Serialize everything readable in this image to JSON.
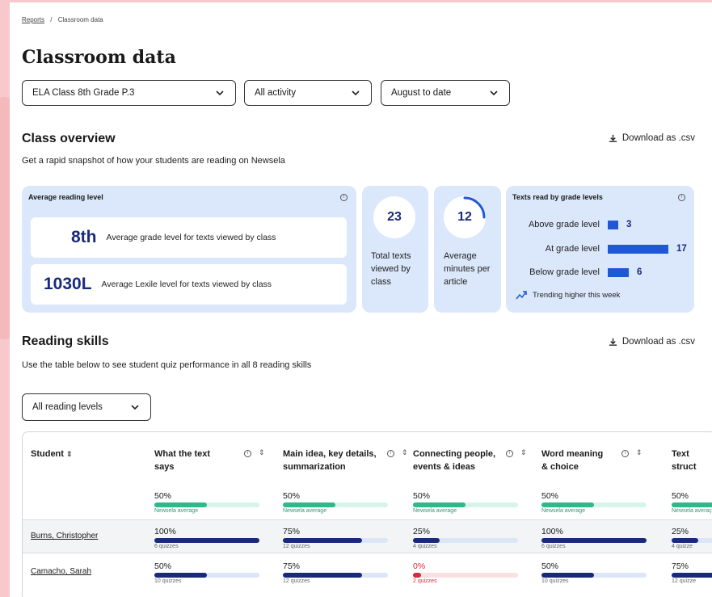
{
  "breadcrumb": {
    "link": "Reports",
    "sep": "/",
    "current": "Classroom data"
  },
  "page_title": "Classroom data",
  "filters": [
    {
      "value": "ELA Class 8th Grade P.3"
    },
    {
      "value": "All activity"
    },
    {
      "value": "August to date"
    }
  ],
  "overview": {
    "title": "Class overview",
    "subtitle": "Get a rapid snapshot of how your students are reading on Newsela",
    "download": "Download as .csv",
    "avg_reading": {
      "title": "Average reading level",
      "grade_value": "8th",
      "grade_desc": "Average grade level for texts viewed by class",
      "lexile_value": "1030L",
      "lexile_desc": "Average Lexile level for texts viewed by class"
    },
    "total_texts": {
      "value": "23",
      "l1": "Total texts",
      "l2": "viewed by",
      "l3": "class"
    },
    "avg_minutes": {
      "value": "12",
      "l1": "Average",
      "l2": "minutes per",
      "l3": "article",
      "ring_fraction": 0.25
    },
    "grade_levels": {
      "title": "Texts read by grade levels",
      "items": [
        {
          "label": "Above grade level",
          "value": "3",
          "num": 3
        },
        {
          "label": "At grade level",
          "value": "17",
          "num": 17
        },
        {
          "label": "Below grade level",
          "value": "6",
          "num": 6
        }
      ],
      "trend": "Trending higher this week"
    }
  },
  "skills": {
    "title": "Reading skills",
    "subtitle": "Use the table below to see student quiz performance in all 8 reading skills",
    "download": "Download as .csv",
    "level_filter": "All reading levels",
    "columns": [
      {
        "l1": "Student",
        "l2": ""
      },
      {
        "l1": "What the text",
        "l2": "says"
      },
      {
        "l1": "Main idea, key details,",
        "l2": "summarization"
      },
      {
        "l1": "Connecting people,",
        "l2": "events & ideas"
      },
      {
        "l1": "Word meaning",
        "l2": "& choice"
      },
      {
        "l1": "Text",
        "l2": "struct"
      }
    ],
    "averages": [
      {
        "pct": "50%",
        "frac": 0.5,
        "label": "Newsela average"
      },
      {
        "pct": "50%",
        "frac": 0.5,
        "label": "Newsela average"
      },
      {
        "pct": "50%",
        "frac": 0.5,
        "label": "Newsela average"
      },
      {
        "pct": "50%",
        "frac": 0.5,
        "label": "Newsela average"
      },
      {
        "pct": "50%",
        "frac": 0.5,
        "label": "Newsela averaç"
      }
    ],
    "students": [
      {
        "name": "Burns,  Christopher",
        "cells": [
          {
            "pct": "100%",
            "frac": 1.0,
            "q": "6 quizzes"
          },
          {
            "pct": "75%",
            "frac": 0.75,
            "q": "12 quizzes"
          },
          {
            "pct": "25%",
            "frac": 0.25,
            "q": "4 quizzes"
          },
          {
            "pct": "100%",
            "frac": 1.0,
            "q": "6 quizzes"
          },
          {
            "pct": "25%",
            "frac": 0.25,
            "q": "4 quizze"
          }
        ]
      },
      {
        "name": "Camacho, Sarah",
        "cells": [
          {
            "pct": "50%",
            "frac": 0.5,
            "q": "10 quizzes"
          },
          {
            "pct": "75%",
            "frac": 0.75,
            "q": "12 quizzes"
          },
          {
            "pct": "0%",
            "frac": 0.0,
            "q": "2 quizzes",
            "alert": true
          },
          {
            "pct": "50%",
            "frac": 0.5,
            "q": "10 quizzes"
          },
          {
            "pct": "75%",
            "frac": 0.75,
            "q": "12 quizze"
          }
        ]
      }
    ]
  },
  "colors": {
    "accent": "#1a2a7a",
    "bar_blue": "#1f57d6",
    "card_bg": "#dbe8fb",
    "avg_green": "#2fb88a",
    "alert_red": "#d62b3a"
  }
}
